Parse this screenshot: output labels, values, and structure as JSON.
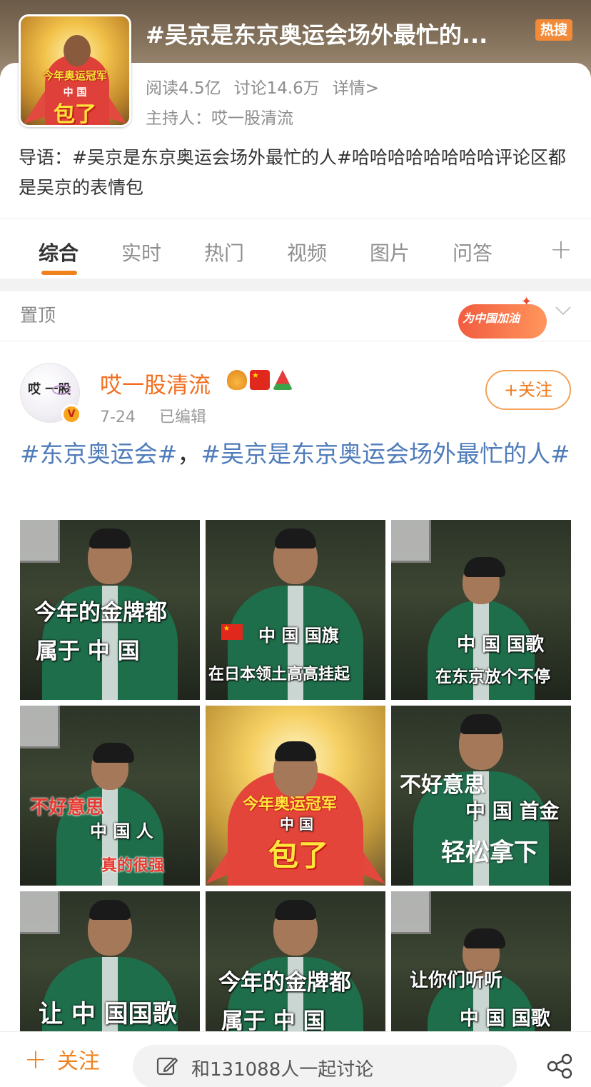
{
  "topic": {
    "title": "#吴京是东京奥运会场外最忙的...",
    "hot_badge": "热搜",
    "reads": "阅读4.5亿",
    "discussions": "讨论14.6万",
    "details_link": "详情>",
    "host": "主持人：哎一股清流",
    "intro": "导语：#吴京是东京奥运会场外最忙的人#哈哈哈哈哈哈哈哈评论区都是吴京的表情包",
    "thumb_caption_top": "今年奥运冠军",
    "thumb_caption_mid": "中 国",
    "thumb_caption_big": "包了"
  },
  "tabs": [
    {
      "label": "综合",
      "active": true
    },
    {
      "label": "实时",
      "active": false
    },
    {
      "label": "热门",
      "active": false
    },
    {
      "label": "视频",
      "active": false
    },
    {
      "label": "图片",
      "active": false
    },
    {
      "label": "问答",
      "active": false
    }
  ],
  "tabs_add": "+",
  "pinned": {
    "label": "置顶",
    "banner_text": "为中国加油"
  },
  "post": {
    "avatar_text": "哎 一股",
    "author": "哎一股清流",
    "date": "7-24",
    "edited": "已编辑",
    "follow_label": "+关注",
    "tag1": "#东京奥运会#",
    "separator": "，",
    "tag2": "#吴京是东京奥运会场外最忙的人#",
    "images": [
      {
        "captions": [
          "今年的金牌都",
          "属于 中 国"
        ]
      },
      {
        "captions": [
          "中 国  国旗",
          "在日本领土高高挂起"
        ]
      },
      {
        "captions": [
          "中 国 国歌",
          "在东京放个不停"
        ]
      },
      {
        "captions": [
          "不好意思",
          "中 国 人",
          "真的很强"
        ]
      },
      {
        "captions": [
          "今年奥运冠军",
          "中 国",
          "包了"
        ]
      },
      {
        "captions": [
          "不好意思",
          "中 国 首金",
          "轻松拿下"
        ]
      },
      {
        "captions": [
          "让 中 国国歌"
        ]
      },
      {
        "captions": [
          "今年的金牌都",
          "属于 中 国"
        ]
      },
      {
        "captions": [
          "让你们听听",
          "中 国 国歌"
        ]
      }
    ]
  },
  "bottom": {
    "follow_label": "关注",
    "discuss_placeholder": "和131088人一起讨论"
  },
  "colors": {
    "accent_orange": "#f0821e",
    "tag_blue": "#4f7cba",
    "hot_badge": "#f28a37"
  }
}
